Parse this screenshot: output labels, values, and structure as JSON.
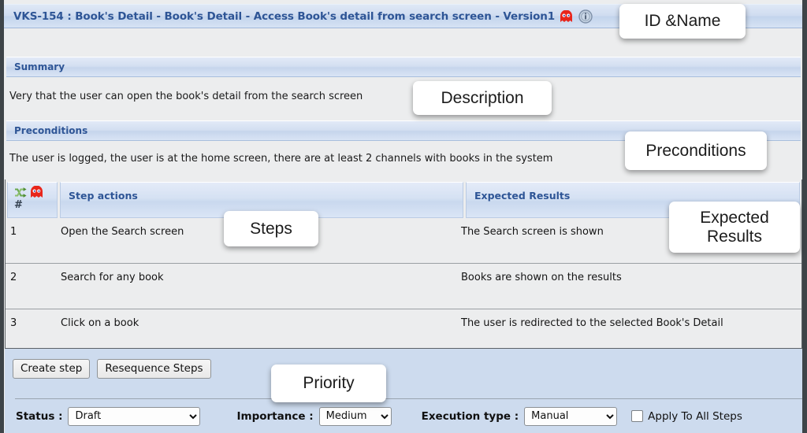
{
  "window": {
    "title": "VKS-154 : Book's Detail - Book's Detail - Access Book's detail from search screen - Version1",
    "title_icons": [
      "ghost-icon",
      "info-icon"
    ]
  },
  "sections": {
    "summary": {
      "header": "Summary",
      "text": "Very that the user can open the book's detail from the search screen"
    },
    "preconditions": {
      "header": "Preconditions",
      "text": "The user is logged, the user is at the home screen, there are at least 2 channels with books in the system"
    }
  },
  "steps_table": {
    "columns": {
      "number": "#",
      "step_actions": "Step actions",
      "expected_results": "Expected Results"
    },
    "header_icons": [
      "shuffle-icon",
      "ghost-icon"
    ],
    "rows": [
      {
        "number": "1",
        "step_actions": "Open the Search screen",
        "expected_results": "The Search screen is shown"
      },
      {
        "number": "2",
        "step_actions": "Search for any book",
        "expected_results": "Books are shown on the results"
      },
      {
        "number": "3",
        "step_actions": "Click on a book",
        "expected_results": "The user is redirected to the selected Book's Detail"
      }
    ]
  },
  "buttons": {
    "create_step": "Create step",
    "resequence_steps": "Resequence Steps"
  },
  "footer": {
    "status_label": "Status :",
    "status_value": "Draft",
    "status_options": [
      "Draft"
    ],
    "importance_label": "Importance :",
    "importance_value": "Medium",
    "importance_options": [
      "Medium"
    ],
    "execution_type_label": "Execution type :",
    "execution_type_value": "Manual",
    "execution_type_options": [
      "Manual"
    ],
    "apply_to_all_steps_label": "Apply To All Steps",
    "apply_to_all_steps_checked": false
  },
  "annotations": [
    {
      "label": "ID &Name"
    },
    {
      "label": "Description"
    },
    {
      "label": "Preconditions"
    },
    {
      "label": "Expected\nResults"
    },
    {
      "label": "Steps"
    },
    {
      "label": "Priority"
    }
  ],
  "colors": {
    "title_text": "#2e5596",
    "band": "#cfdcf0",
    "body_bg": "#ecedee",
    "footer_bg": "#cddbee",
    "ghost": "#e8261c",
    "shuffle": "#6aa84f"
  }
}
